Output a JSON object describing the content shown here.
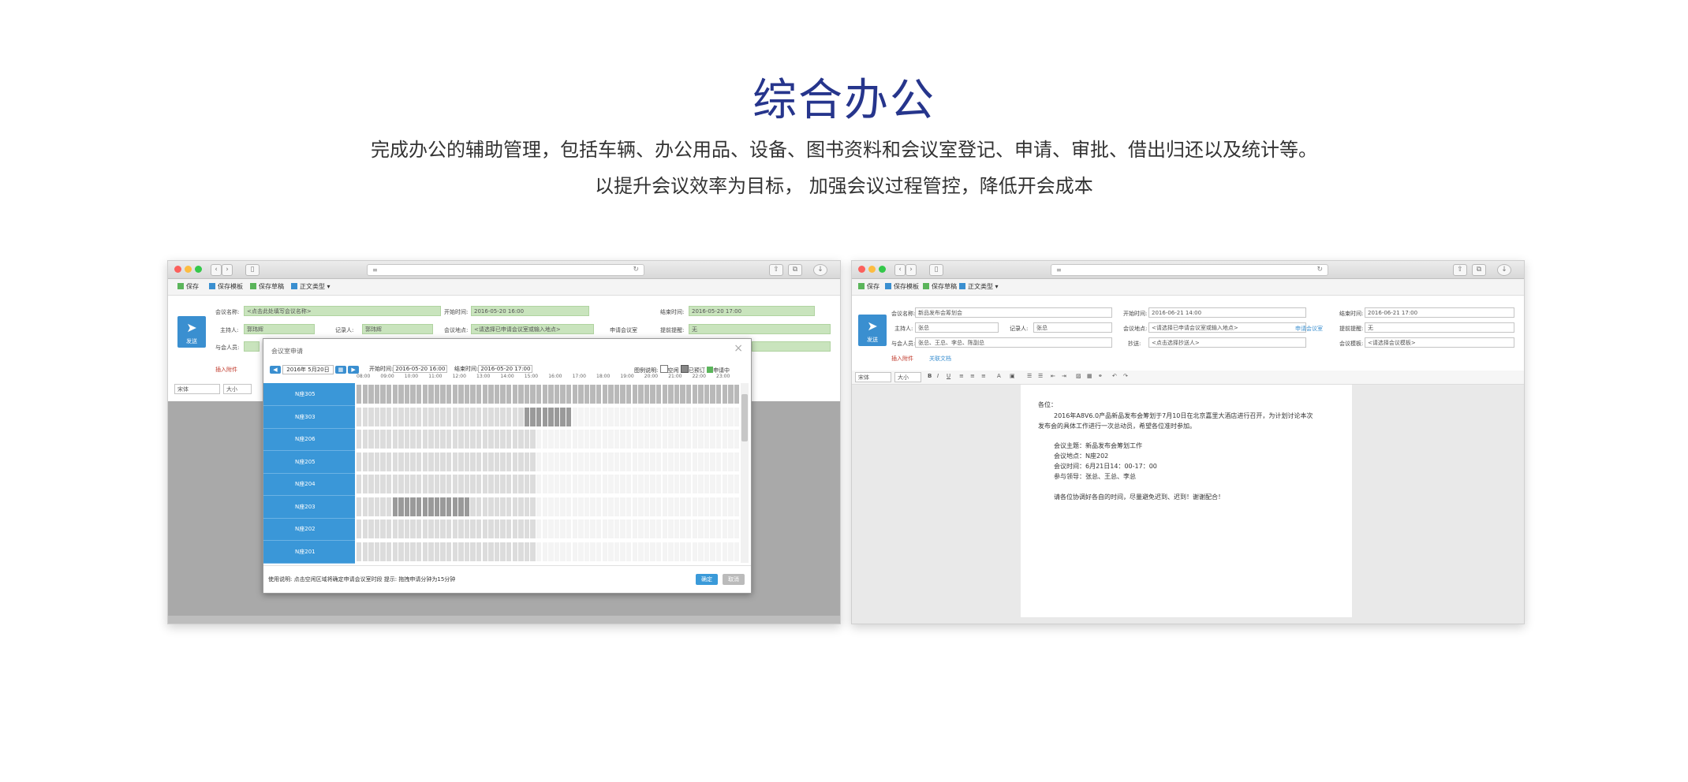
{
  "header": {
    "title": "综合办公",
    "line1": "完成办公的辅助管理，包括车辆、办公用品、设备、图书资料和会议室登记、申请、审批、借出归还以及统计等。",
    "line2": "以提升会议效率为目标， 加强会议过程管控，降低开会成本"
  },
  "left_window": {
    "toolbar": [
      "保存",
      "保存模板",
      "保存草稿",
      "正文类型"
    ],
    "send_label": "发送",
    "form": {
      "meeting_name_label": "会议名称:",
      "meeting_name_value": "<点击此处填写会议名称>",
      "start_label": "开始时间:",
      "start_value": "2016-05-20 16:00",
      "end_label": "结束时间:",
      "end_value": "2016-05-20 17:00",
      "host_label": "主持人:",
      "host_value": "郭玮辉",
      "recorder_label": "记录人:",
      "recorder_value": "郭玮辉",
      "place_label": "会议地点:",
      "place_value": "<请选择已申请会议室或输入地点>",
      "apply_room": "申请会议室",
      "remind_label": "提前提醒:",
      "remind_value": "无",
      "attendee_label": "与会人员:",
      "font_select": "宋体",
      "size_select": "大小",
      "insert_label": "插入附件"
    },
    "dialog": {
      "title": "会议室申请",
      "month": "2016年 5月20日",
      "start_time_label": "开始时间:",
      "start_time": "2016-05-20 16:00",
      "end_time_label": "结束时间:",
      "end_time": "2016-05-20 17:00",
      "legend_label": "图例说明:",
      "legend": [
        "空闲",
        "已预订",
        "申请中"
      ],
      "hours": [
        "08:00",
        "09:00",
        "10:00",
        "11:00",
        "12:00",
        "13:00",
        "14:00",
        "15:00",
        "16:00",
        "17:00",
        "18:00",
        "19:00",
        "20:00",
        "21:00",
        "22:00",
        "23:00"
      ],
      "rooms": [
        "N座305",
        "N座303",
        "N座206",
        "N座205",
        "N座204",
        "N座203",
        "N座202",
        "N座201"
      ],
      "footer": "使用说明: 点击空闲区域将确定申请会议室时段 提示: 拖拽申请分钟为15分钟",
      "ok": "确定",
      "cancel": "取消"
    }
  },
  "right_window": {
    "toolbar": [
      "保存",
      "保存模板",
      "保存草稿",
      "正文类型"
    ],
    "send_label": "发送",
    "form": {
      "meeting_name_label": "会议名称:",
      "meeting_name_value": "新品发布会筹划会",
      "start_label": "开始时间:",
      "start_value": "2016-06-21 14:00",
      "end_label": "结束时间:",
      "end_value": "2016-06-21 17:00",
      "host_label": "主持人:",
      "host_value": "张总",
      "recorder_label": "记录人:",
      "recorder_value": "张总",
      "place_label": "会议地点:",
      "place_value": "<请选择已申请会议室或输入地点>",
      "apply_room": "申请会议室",
      "remind_label": "提前提醒:",
      "remind_value": "无",
      "attendee_label": "与会人员:",
      "attendee_value": "张总、王总、李总、陈副总",
      "copy_label": "抄送:",
      "copy_value": "<点击选择抄送人>",
      "template_label": "会议模板:",
      "template_value": "<请选择会议模板>",
      "insert_label": "插入附件",
      "related_label": "关联文档",
      "font_select": "宋体",
      "size_select": "大小"
    },
    "doc": {
      "greeting": "各位：",
      "body1": "2016年A8V6.0产品新品发布会筹划于7月10日在北京嘉里大酒店进行召开，为计划讨论本次",
      "body2": "发布会的具体工作进行一次总动员，希望各位准时参加。",
      "topic": "会议主题：新品发布会筹划工作",
      "place": "会议地点：N座202",
      "time": "会议时间：6月21日14：00-17：00",
      "people": "参与领导：张总、王总、李总",
      "closing": "请各位协调好各自的时间，尽量避免迟到、迟到！谢谢配合！"
    }
  }
}
